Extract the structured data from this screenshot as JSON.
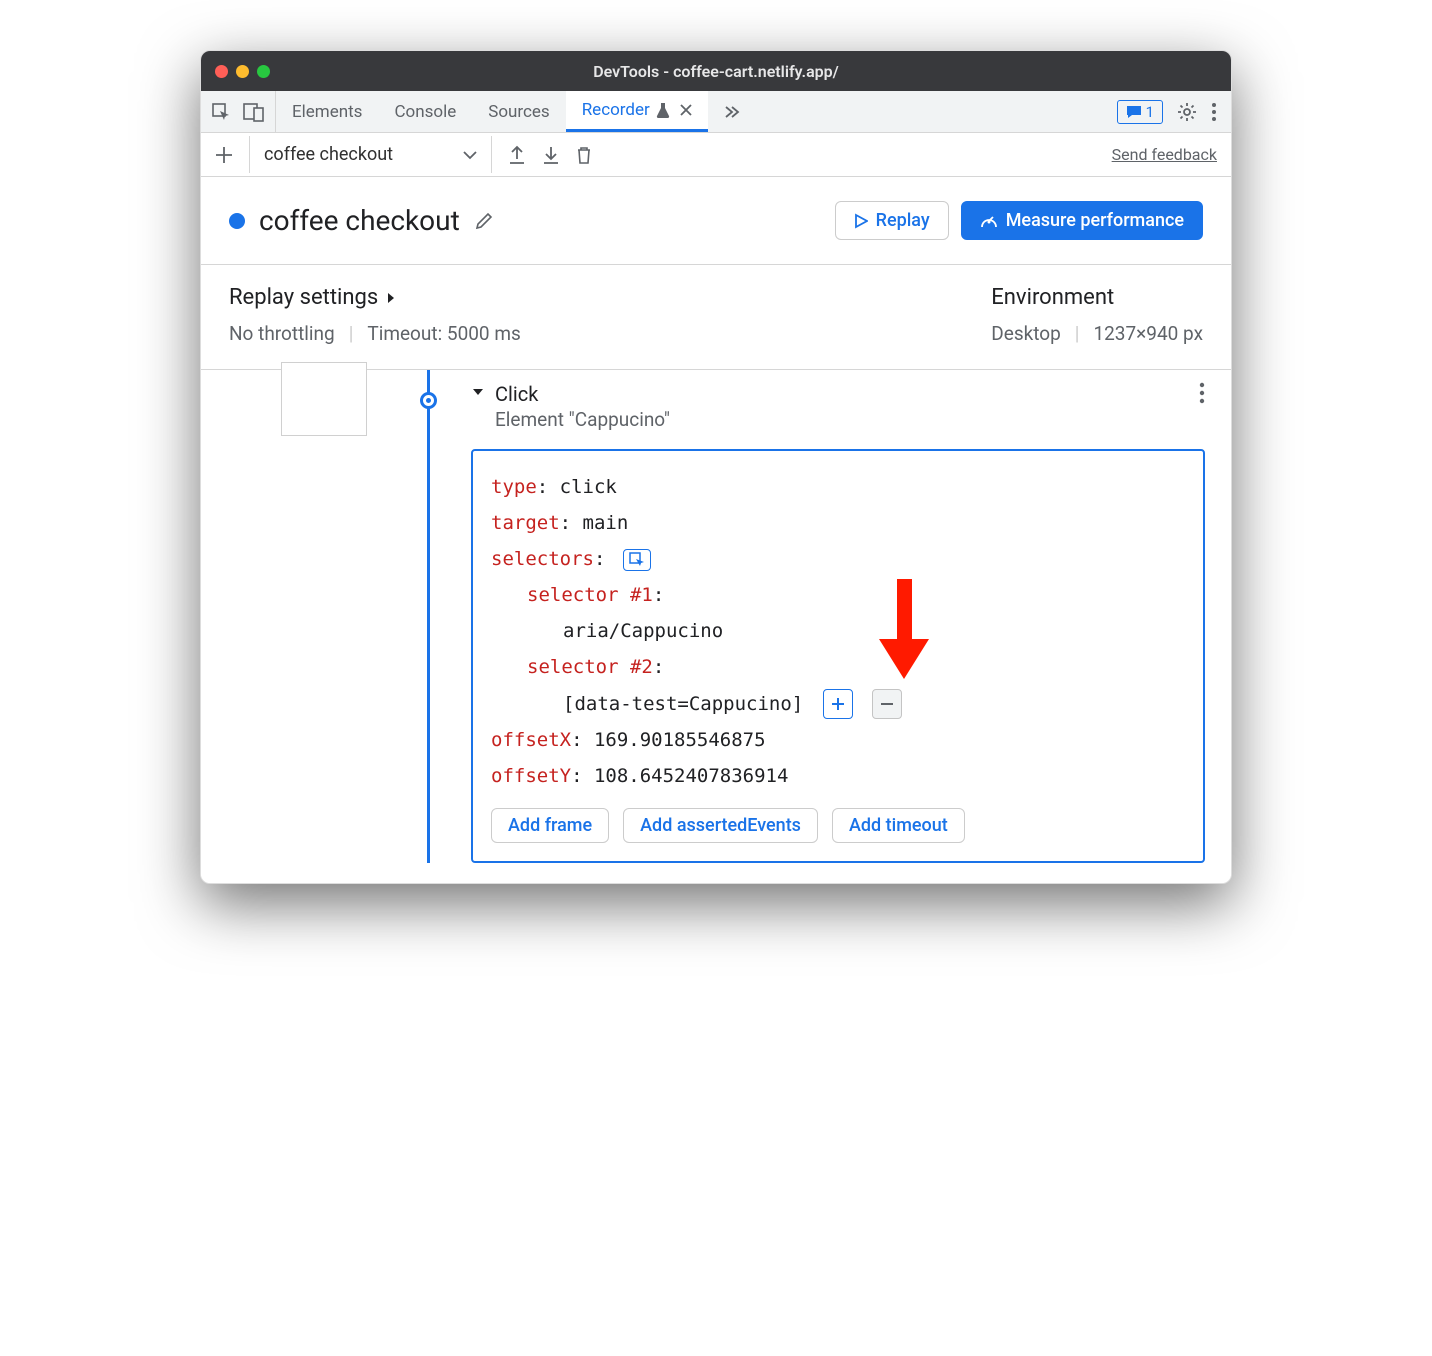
{
  "window": {
    "title": "DevTools - coffee-cart.netlify.app/"
  },
  "tabs": {
    "items": [
      "Elements",
      "Console",
      "Sources",
      "Recorder"
    ],
    "active": "Recorder",
    "messages_count": "1"
  },
  "toolbar": {
    "recording_name": "coffee checkout",
    "feedback": "Send feedback"
  },
  "header": {
    "title": "coffee checkout",
    "replay": "Replay",
    "measure": "Measure performance"
  },
  "settings": {
    "replay_title": "Replay settings",
    "throttling": "No throttling",
    "timeout": "Timeout: 5000 ms",
    "env_title": "Environment",
    "device": "Desktop",
    "viewport": "1237×940 px"
  },
  "step": {
    "title": "Click",
    "subtitle": "Element \"Cappucino\"",
    "props": {
      "type_k": "type",
      "type_v": ": click",
      "target_k": "target",
      "target_v": ": main",
      "selectors_k": "selectors",
      "selectors_v": ":",
      "sel1_k": "selector #1",
      "sel1_v": ":",
      "sel1_val": "aria/Cappucino",
      "sel2_k": "selector #2",
      "sel2_v": ":",
      "sel2_val": "[data-test=Cappucino]",
      "offx_k": "offsetX",
      "offx_v": ": 169.90185546875",
      "offy_k": "offsetY",
      "offy_v": ": 108.6452407836914"
    },
    "add_frame": "Add frame",
    "add_asserted": "Add assertedEvents",
    "add_timeout": "Add timeout"
  }
}
